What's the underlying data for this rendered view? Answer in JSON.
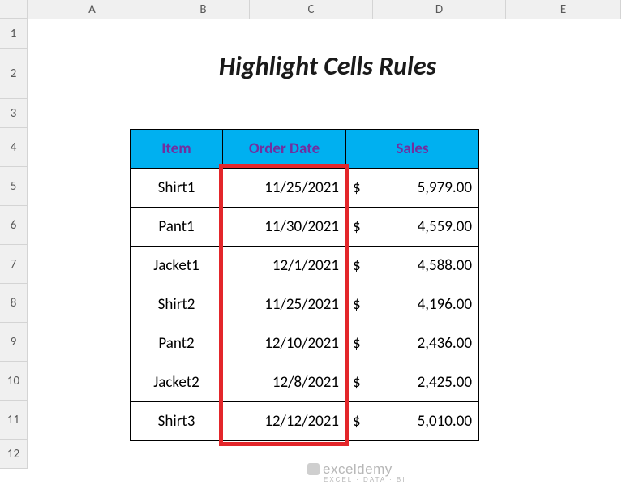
{
  "columns": {
    "A": "A",
    "B": "B",
    "C": "C",
    "D": "D",
    "E": "E"
  },
  "rows": {
    "r1": "1",
    "r2": "2",
    "r3": "3",
    "r4": "4",
    "r5": "5",
    "r6": "6",
    "r7": "7",
    "r8": "8",
    "r9": "9",
    "r10": "10",
    "r11": "11",
    "r12": "12"
  },
  "title": "Highlight Cells Rules",
  "headers": {
    "item": "Item",
    "date": "Order Date",
    "sales": "Sales"
  },
  "currency": "$",
  "data": {
    "r0": {
      "item": "Shirt1",
      "date": "11/25/2021",
      "sales": "5,979.00"
    },
    "r1": {
      "item": "Pant1",
      "date": "11/30/2021",
      "sales": "4,559.00"
    },
    "r2": {
      "item": "Jacket1",
      "date": "12/1/2021",
      "sales": "4,588.00"
    },
    "r3": {
      "item": "Shirt2",
      "date": "11/25/2021",
      "sales": "4,196.00"
    },
    "r4": {
      "item": "Pant2",
      "date": "12/10/2021",
      "sales": "2,436.00"
    },
    "r5": {
      "item": "Jacket2",
      "date": "12/8/2021",
      "sales": "2,425.00"
    },
    "r6": {
      "item": "Shirt3",
      "date": "12/12/2021",
      "sales": "5,010.00"
    }
  },
  "watermark": {
    "main": "exceldemy",
    "sub": "EXCEL · DATA · BI"
  },
  "chart_data": {
    "type": "table",
    "title": "Highlight Cells Rules",
    "columns": [
      "Item",
      "Order Date",
      "Sales"
    ],
    "rows": [
      [
        "Shirt1",
        "11/25/2021",
        5979.0
      ],
      [
        "Pant1",
        "11/30/2021",
        4559.0
      ],
      [
        "Jacket1",
        "12/1/2021",
        4588.0
      ],
      [
        "Shirt2",
        "11/25/2021",
        4196.0
      ],
      [
        "Pant2",
        "12/10/2021",
        2436.0
      ],
      [
        "Jacket2",
        "12/8/2021",
        2425.0
      ],
      [
        "Shirt3",
        "12/12/2021",
        5010.0
      ]
    ],
    "highlighted_column": "Order Date",
    "currency_column": "Sales",
    "currency_symbol": "$"
  }
}
